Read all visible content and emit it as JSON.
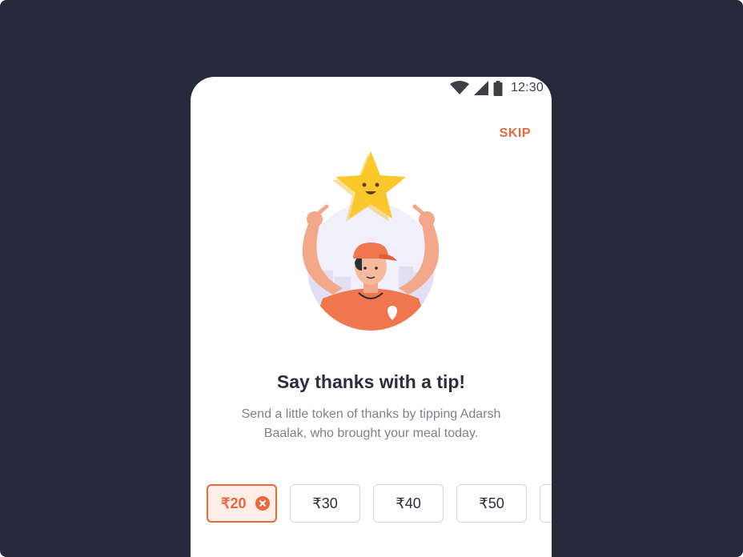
{
  "status_bar": {
    "time": "12:30",
    "icons": [
      "wifi-icon",
      "cellular-signal-icon",
      "battery-icon"
    ]
  },
  "header": {
    "skip_label": "SKIP"
  },
  "illustration": {
    "description_icon": "delivery-person-pointing-at-smiling-star"
  },
  "content": {
    "title": "Say thanks with a tip!",
    "subtitle": "Send a little token of thanks by tipping Adarsh Baalak, who brought your meal today."
  },
  "tips": {
    "options": [
      {
        "label": "₹20",
        "selected": true
      },
      {
        "label": "₹30",
        "selected": false
      },
      {
        "label": "₹40",
        "selected": false
      },
      {
        "label": "₹50",
        "selected": false
      }
    ]
  },
  "colors": {
    "background": "#262a3d",
    "accent": "#e8673c",
    "selected_fill": "#fdeee7",
    "text_primary": "#2b2e3b",
    "text_secondary": "#7e818c"
  }
}
